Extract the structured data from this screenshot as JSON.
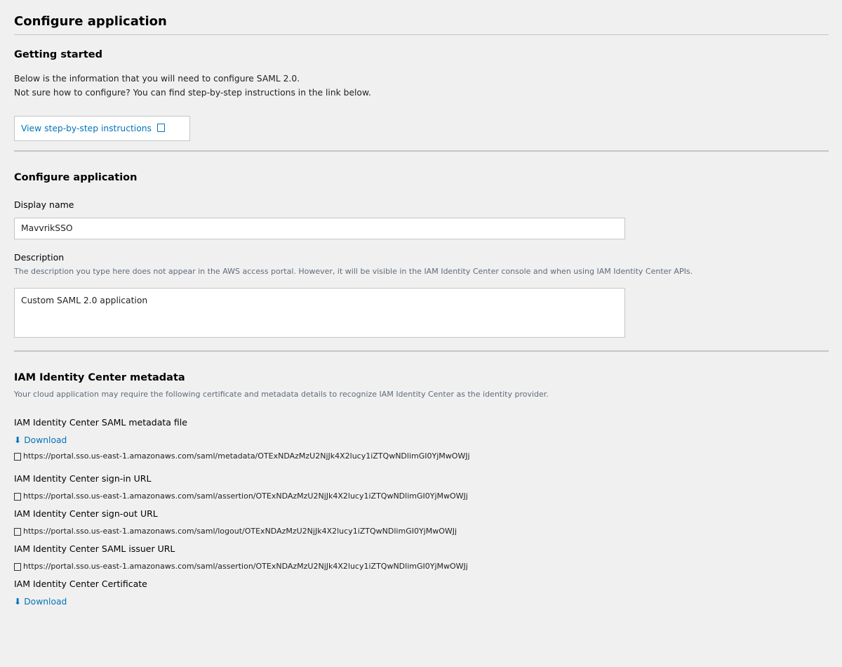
{
  "page_title": "Configure application",
  "getting_started": {
    "title": "Getting started",
    "line1": "Below is the information that you will need to configure SAML 2.0.",
    "line2": "Not sure how to configure? You can find step-by-step instructions in the link below.",
    "button_label": "View step-by-step instructions"
  },
  "configure": {
    "title": "Configure application",
    "display_name_label": "Display name",
    "display_name_value": "MavvrikSSO",
    "description_label": "Description",
    "description_help": "The description you type here does not appear in the AWS access portal. However, it will be visible in the IAM Identity Center console and when using IAM Identity Center APIs.",
    "description_value": "Custom SAML 2.0 application"
  },
  "metadata": {
    "title": "IAM Identity Center metadata",
    "help": "Your cloud application may require the following certificate and metadata details to recognize IAM Identity Center as the identity provider.",
    "metadata_file_label": "IAM Identity Center SAML metadata file",
    "download_label": "⬇ Download",
    "metadata_url": "https://portal.sso.us-east-1.amazonaws.com/saml/metadata/OTExNDAzMzU2NjJk4X2lucy1iZTQwNDlimGI0YjMwOWJj",
    "signin_label": "IAM Identity Center sign-in URL",
    "signin_url": "https://portal.sso.us-east-1.amazonaws.com/saml/assertion/OTExNDAzMzU2NjJk4X2lucy1iZTQwNDlimGI0YjMwOWJj",
    "signout_label": "IAM Identity Center sign-out URL",
    "signout_url": "https://portal.sso.us-east-1.amazonaws.com/saml/logout/OTExNDAzMzU2NjJk4X2lucy1iZTQwNDlimGI0YjMwOWJj",
    "issuer_label": "IAM Identity Center SAML issuer URL",
    "issuer_url": "https://portal.sso.us-east-1.amazonaws.com/saml/assertion/OTExNDAzMzU2NjJk4X2lucy1iZTQwNDlimGI0YjMwOWJj",
    "certificate_label": "IAM Identity Center Certificate",
    "certificate_download_label": "⬇ Download"
  },
  "colors": {
    "link": "#0073bb",
    "background": "#f0f0f0",
    "divider": "#c6c6c6"
  }
}
